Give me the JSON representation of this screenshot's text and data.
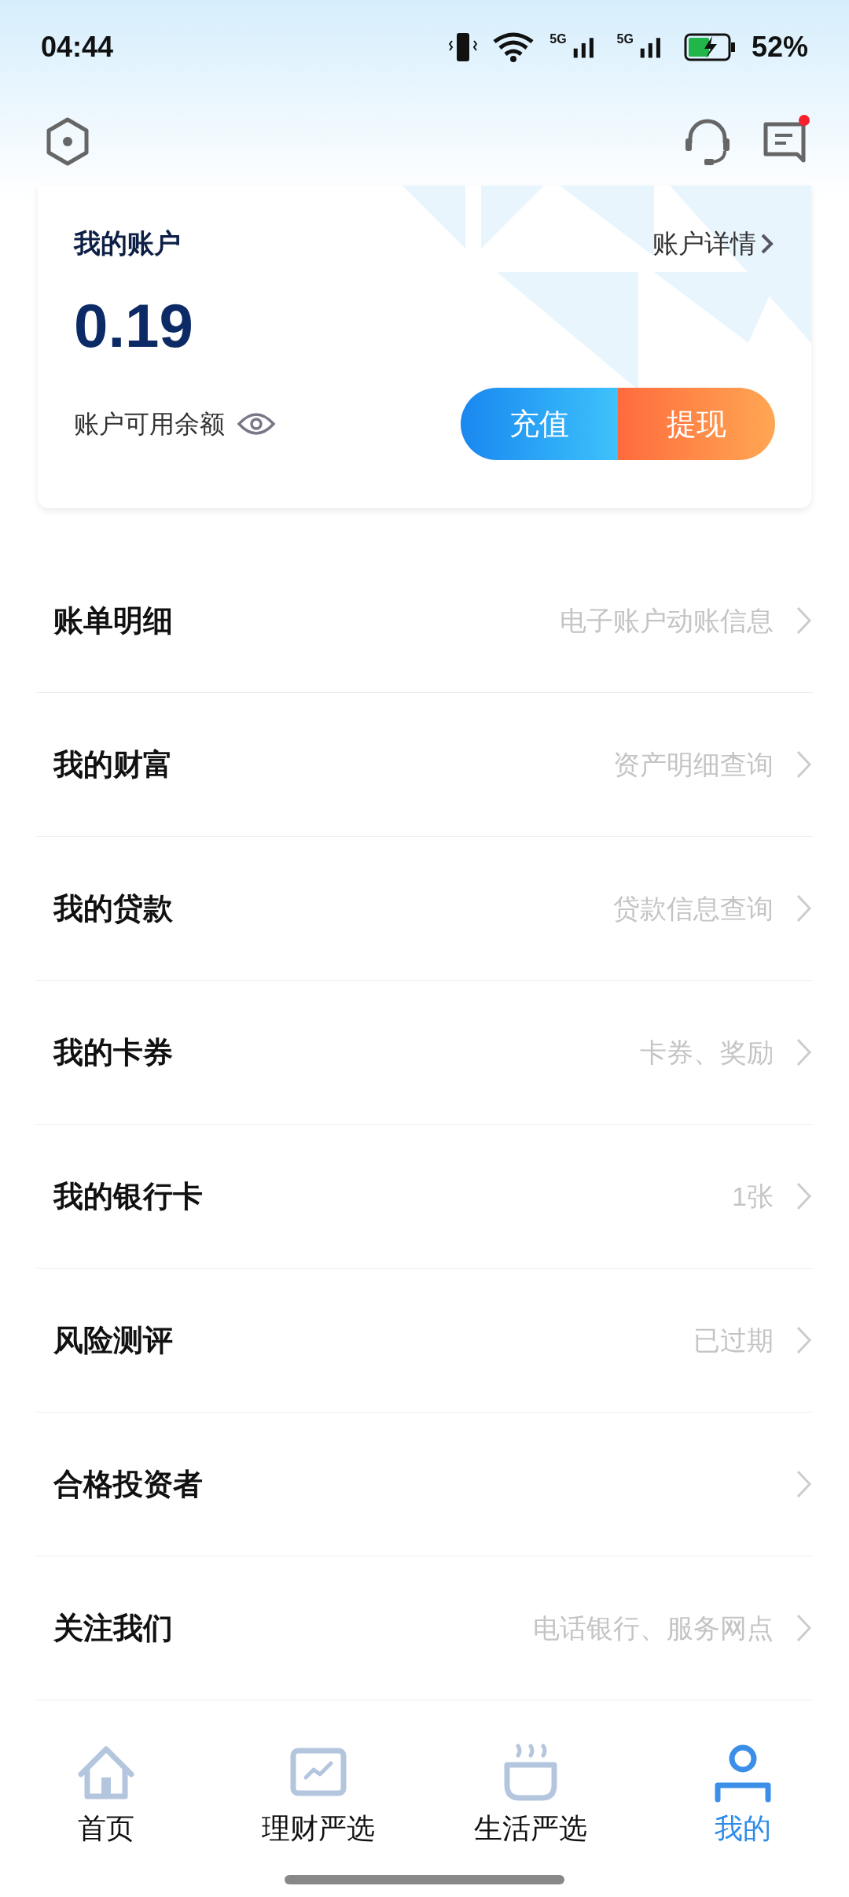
{
  "status_bar": {
    "time": "04:44",
    "networks": [
      "5G",
      "5G"
    ],
    "battery": "52%"
  },
  "account": {
    "title": "我的账户",
    "details_link": "账户详情",
    "balance": "0.19",
    "balance_label": "账户可用余额",
    "buttons": [
      {
        "label": "充值",
        "kind": "recharge"
      },
      {
        "label": "提现",
        "kind": "withdraw"
      }
    ]
  },
  "menu": [
    {
      "label": "账单明细",
      "hint": "电子账户动账信息"
    },
    {
      "label": "我的财富",
      "hint": "资产明细查询"
    },
    {
      "label": "我的贷款",
      "hint": "贷款信息查询"
    },
    {
      "label": "我的卡券",
      "hint": "卡券、奖励"
    },
    {
      "label": "我的银行卡",
      "hint": "1张"
    },
    {
      "label": "风险测评",
      "hint": "已过期"
    },
    {
      "label": "合格投资者"
    },
    {
      "label": "关注我们",
      "hint": "电话银行、服务网点"
    }
  ],
  "messages": {
    "unread": true
  },
  "tab_bar": [
    {
      "label": "首页",
      "kind": "home",
      "selected": false
    },
    {
      "label": "理财严选",
      "kind": "wealth",
      "selected": false
    },
    {
      "label": "生活严选",
      "kind": "life",
      "selected": false
    },
    {
      "label": "我的",
      "kind": "mine",
      "selected": true
    }
  ]
}
